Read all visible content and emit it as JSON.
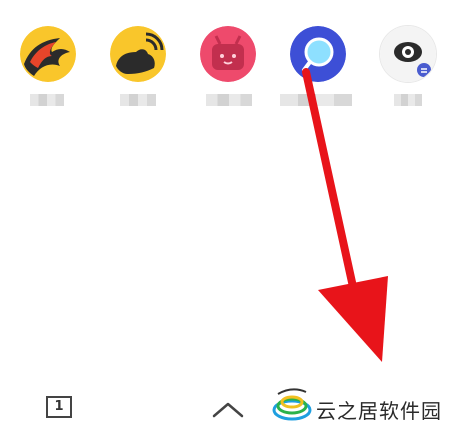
{
  "apps": [
    {
      "icon": "fire-app-icon",
      "label": ""
    },
    {
      "icon": "rss-hand-app-icon",
      "label": ""
    },
    {
      "icon": "bilibili-tv-app-icon",
      "label": ""
    },
    {
      "icon": "magnifier-app-icon",
      "label": ""
    },
    {
      "icon": "eye-lens-app-icon",
      "label": ""
    }
  ],
  "bottom_bar": {
    "tab_count": "1",
    "chevron_icon": "chevron-up-icon"
  },
  "watermark": {
    "text": "云之居软件园",
    "logo_icon": "swirl-logo-icon"
  },
  "colors": {
    "annotation_arrow": "#e8141a",
    "icon_yellow": "#f9c62b",
    "icon_pink": "#ee4a6c",
    "icon_blue": "#3d4fd6"
  }
}
